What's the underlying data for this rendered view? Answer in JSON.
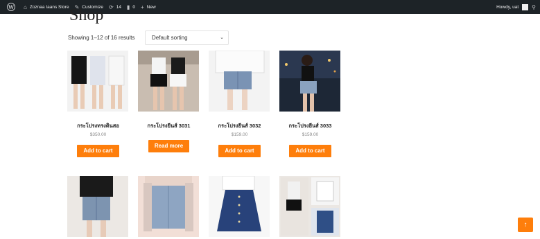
{
  "admin_bar": {
    "site_name": "Zoznaa Iaans Store",
    "customize": "Customize",
    "updates_count": "14",
    "comments_count": "0",
    "new_label": "New",
    "howdy": "Howdy, uat"
  },
  "page": {
    "title": "Shop"
  },
  "shop": {
    "result_count": "Showing 1–12 of 16 results",
    "sorting_selected": "Default sorting"
  },
  "products": [
    {
      "title": "กระโปรงทรงดินสอ",
      "price": "$350.00",
      "button": "Add to cart"
    },
    {
      "title": "กระโปรงยีนส์ 3031",
      "price": "",
      "button": "Read more"
    },
    {
      "title": "กระโปรงยีนส์ 3032",
      "price": "$159.00",
      "button": "Add to cart"
    },
    {
      "title": "กระโปรงยีนส์ 3033",
      "price": "$159.00",
      "button": "Add to cart"
    }
  ],
  "scroll_top": {
    "label": "↑"
  },
  "colors": {
    "accent": "#fe7e0b",
    "admin_bar": "#1d2327"
  },
  "icons": [
    "wordpress-icon",
    "home-icon",
    "customize-icon",
    "updates-icon",
    "comments-icon",
    "plus-icon",
    "avatar-icon",
    "search-icon",
    "chevron-down-icon",
    "arrow-up-icon"
  ]
}
